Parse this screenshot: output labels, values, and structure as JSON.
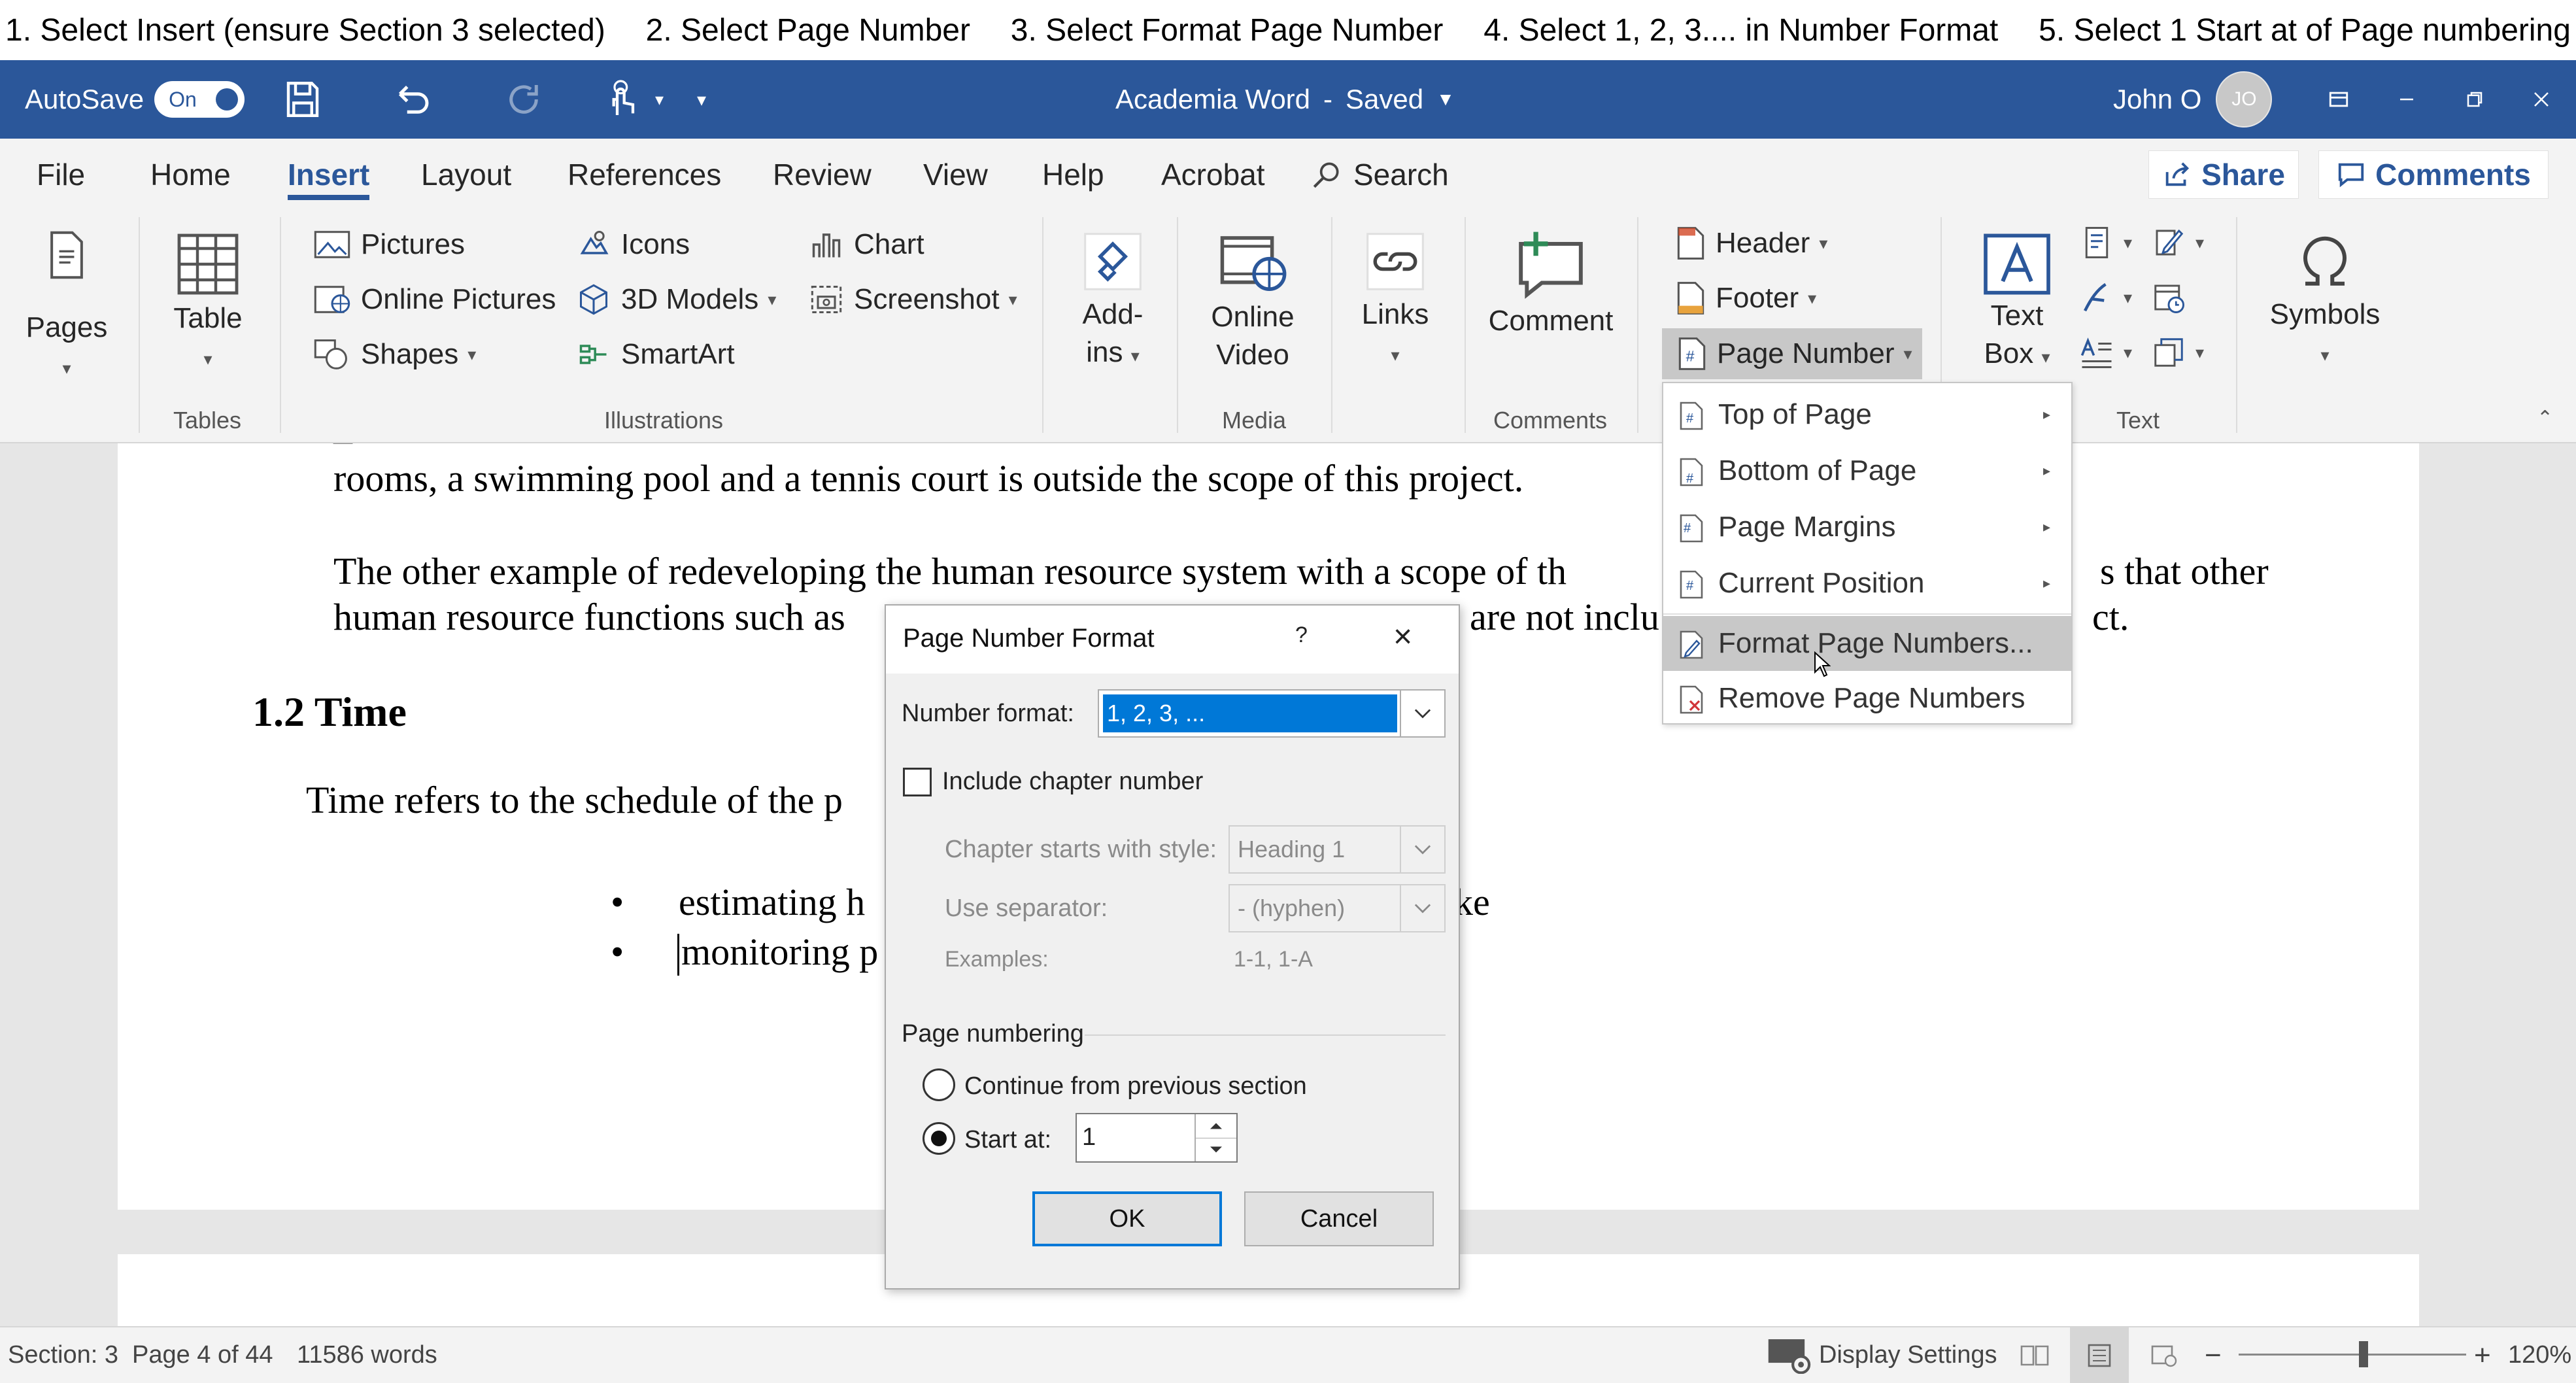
{
  "instructions": [
    "1. Select Insert (ensure Section 3 selected)",
    "2. Select Page Number",
    "3. Select Format Page Number",
    "4. Select 1, 2, 3.... in Number Format",
    "5. Select 1 Start at of Page numbering"
  ],
  "titlebar": {
    "autosave_label": "AutoSave",
    "autosave_state": "On",
    "document_title": "Academia Word",
    "title_separator": "-",
    "save_status": "Saved",
    "user_name": "John O",
    "user_initials": "JO"
  },
  "tabs": [
    "File",
    "Home",
    "Insert",
    "Layout",
    "References",
    "Review",
    "View",
    "Help",
    "Acrobat"
  ],
  "active_tab": "Insert",
  "search_label": "Search",
  "share_label": "Share",
  "comments_label": "Comments",
  "ribbon": {
    "pages": "Pages",
    "table": "Table",
    "tables_group": "Tables",
    "pictures": "Pictures",
    "online_pictures": "Online Pictures",
    "shapes": "Shapes",
    "icons": "Icons",
    "models_3d": "3D Models",
    "smartart": "SmartArt",
    "chart": "Chart",
    "screenshot": "Screenshot",
    "illustrations_group": "Illustrations",
    "addins_line1": "Add-",
    "addins_line2": "ins",
    "online_video_line1": "Online",
    "online_video_line2": "Video",
    "media_group": "Media",
    "links": "Links",
    "comment": "Comment",
    "comments_group": "Comments",
    "header": "Header",
    "footer": "Footer",
    "page_number": "Page Number",
    "textbox_line1": "Text",
    "textbox_line2": "Box",
    "text_group": "Text",
    "symbols": "Symbols"
  },
  "page_number_menu": [
    {
      "label": "Top of Page",
      "submenu": true
    },
    {
      "label": "Bottom of Page",
      "submenu": true
    },
    {
      "label": "Page Margins",
      "submenu": true
    },
    {
      "label": "Current Position",
      "submenu": true
    },
    {
      "label": "Format Page Numbers...",
      "submenu": false,
      "highlighted": true
    },
    {
      "label": "Remove Page Numbers",
      "submenu": false
    }
  ],
  "document": {
    "line1": "rooms, a swimming pool and a tennis court is outside the scope of this project.",
    "line2a": "The other example of redeveloping the human resource system with a scope of th",
    "line2b": "s that other",
    "line3a": "human resource functions such as",
    "line3b": "are not inclu",
    "line3c": "ct.",
    "heading": "1.2 Time",
    "para": "Time refers to the schedule of the p",
    "bullet1a": "estimating h",
    "bullet1b": "ke",
    "bullet2": "monitoring p"
  },
  "dialog": {
    "title": "Page Number Format",
    "help": "?",
    "close": "×",
    "number_format_label": "Number format:",
    "number_format_value": "1, 2, 3, ...",
    "include_chapter_label": "Include chapter number",
    "include_chapter_checked": false,
    "chapter_style_label": "Chapter starts with style:",
    "chapter_style_value": "Heading 1",
    "separator_label": "Use separator:",
    "separator_value": "-   (hyphen)",
    "examples_label": "Examples:",
    "examples_value": "1-1, 1-A",
    "page_numbering_label": "Page numbering",
    "continue_label": "Continue from previous section",
    "start_at_label": "Start at:",
    "start_at_value": "1",
    "selected_option": "start_at",
    "ok": "OK",
    "cancel": "Cancel"
  },
  "statusbar": {
    "section": "Section: 3",
    "page": "Page 4 of 44",
    "words": "11586 words",
    "display_settings": "Display Settings",
    "zoom_minus": "−",
    "zoom_plus": "+",
    "zoom": "120%",
    "zoom_level_fraction": 0.55
  },
  "colors": {
    "accent": "#2b579a",
    "selection": "#0078d7",
    "menu_hover": "#c8c8c8"
  }
}
